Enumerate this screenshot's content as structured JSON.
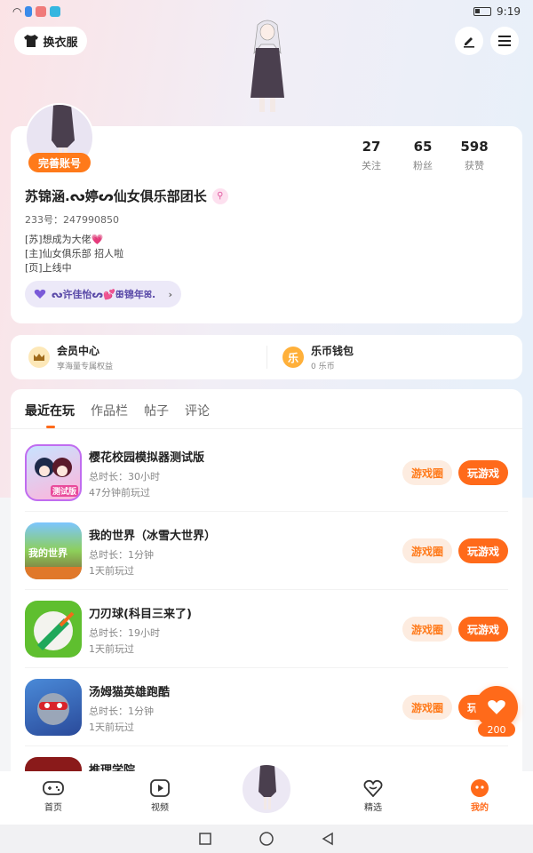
{
  "status_bar": {
    "time": "9:19"
  },
  "header": {
    "outfit_label": "换衣服"
  },
  "profile": {
    "complete_label": "完善账号",
    "stats": [
      {
        "value": "27",
        "label": "关注"
      },
      {
        "value": "65",
        "label": "粉丝"
      },
      {
        "value": "598",
        "label": "获赞"
      }
    ],
    "nickname": "苏锦涵.ᔓ婷ᔕ仙女俱乐部团长",
    "uid": "233号：247990850",
    "bio": [
      "[苏]想成为大佬💗",
      "[主]仙女俱乐部 招人啦",
      "[页]上线中"
    ],
    "club_chip": "ᔓ许佳怡ᔕ💕ꕥ锦年ꕤ."
  },
  "member": {
    "vip_title": "会员中心",
    "vip_sub": "享海量专属权益",
    "wallet_title": "乐币钱包",
    "wallet_sub": "0 乐币",
    "wallet_icon_char": "乐"
  },
  "tabs": [
    "最近在玩",
    "作品栏",
    "帖子",
    "评论"
  ],
  "games": [
    {
      "name": "樱花校园模拟器测试版",
      "duration": "总时长：30小时",
      "last_played": "47分钟前玩过",
      "circle_label": "游戏圈",
      "play_label": "玩游戏",
      "icon_text": "测试版"
    },
    {
      "name": "我的世界（冰雪大世界）",
      "duration": "总时长：1分钟",
      "last_played": "1天前玩过",
      "circle_label": "游戏圈",
      "play_label": "玩游戏",
      "icon_text": "我的世界"
    },
    {
      "name": "刀刃球(科目三来了)",
      "duration": "总时长：19小时",
      "last_played": "1天前玩过",
      "circle_label": "游戏圈",
      "play_label": "玩游戏",
      "icon_text": ""
    },
    {
      "name": "汤姆猫英雄跑酷",
      "duration": "总时长：1分钟",
      "last_played": "1天前玩过",
      "circle_label": "游戏圈",
      "play_label": "玩游戏",
      "icon_text": ""
    },
    {
      "name": "推理学院",
      "duration": "",
      "last_played": "",
      "circle_label": "",
      "play_label": "",
      "icon_text": ""
    }
  ],
  "favorite": {
    "count": "200"
  },
  "bottom_nav": [
    {
      "label": "首页",
      "icon": "gamepad-icon"
    },
    {
      "label": "视频",
      "icon": "video-icon"
    },
    {
      "label": "精选",
      "icon": "featured-icon"
    },
    {
      "label": "我的",
      "icon": "profile-icon",
      "active": true
    }
  ],
  "colors": {
    "accent": "#ff6a1a",
    "soft_accent": "#fdece0",
    "bg": "#f4f5f7"
  }
}
